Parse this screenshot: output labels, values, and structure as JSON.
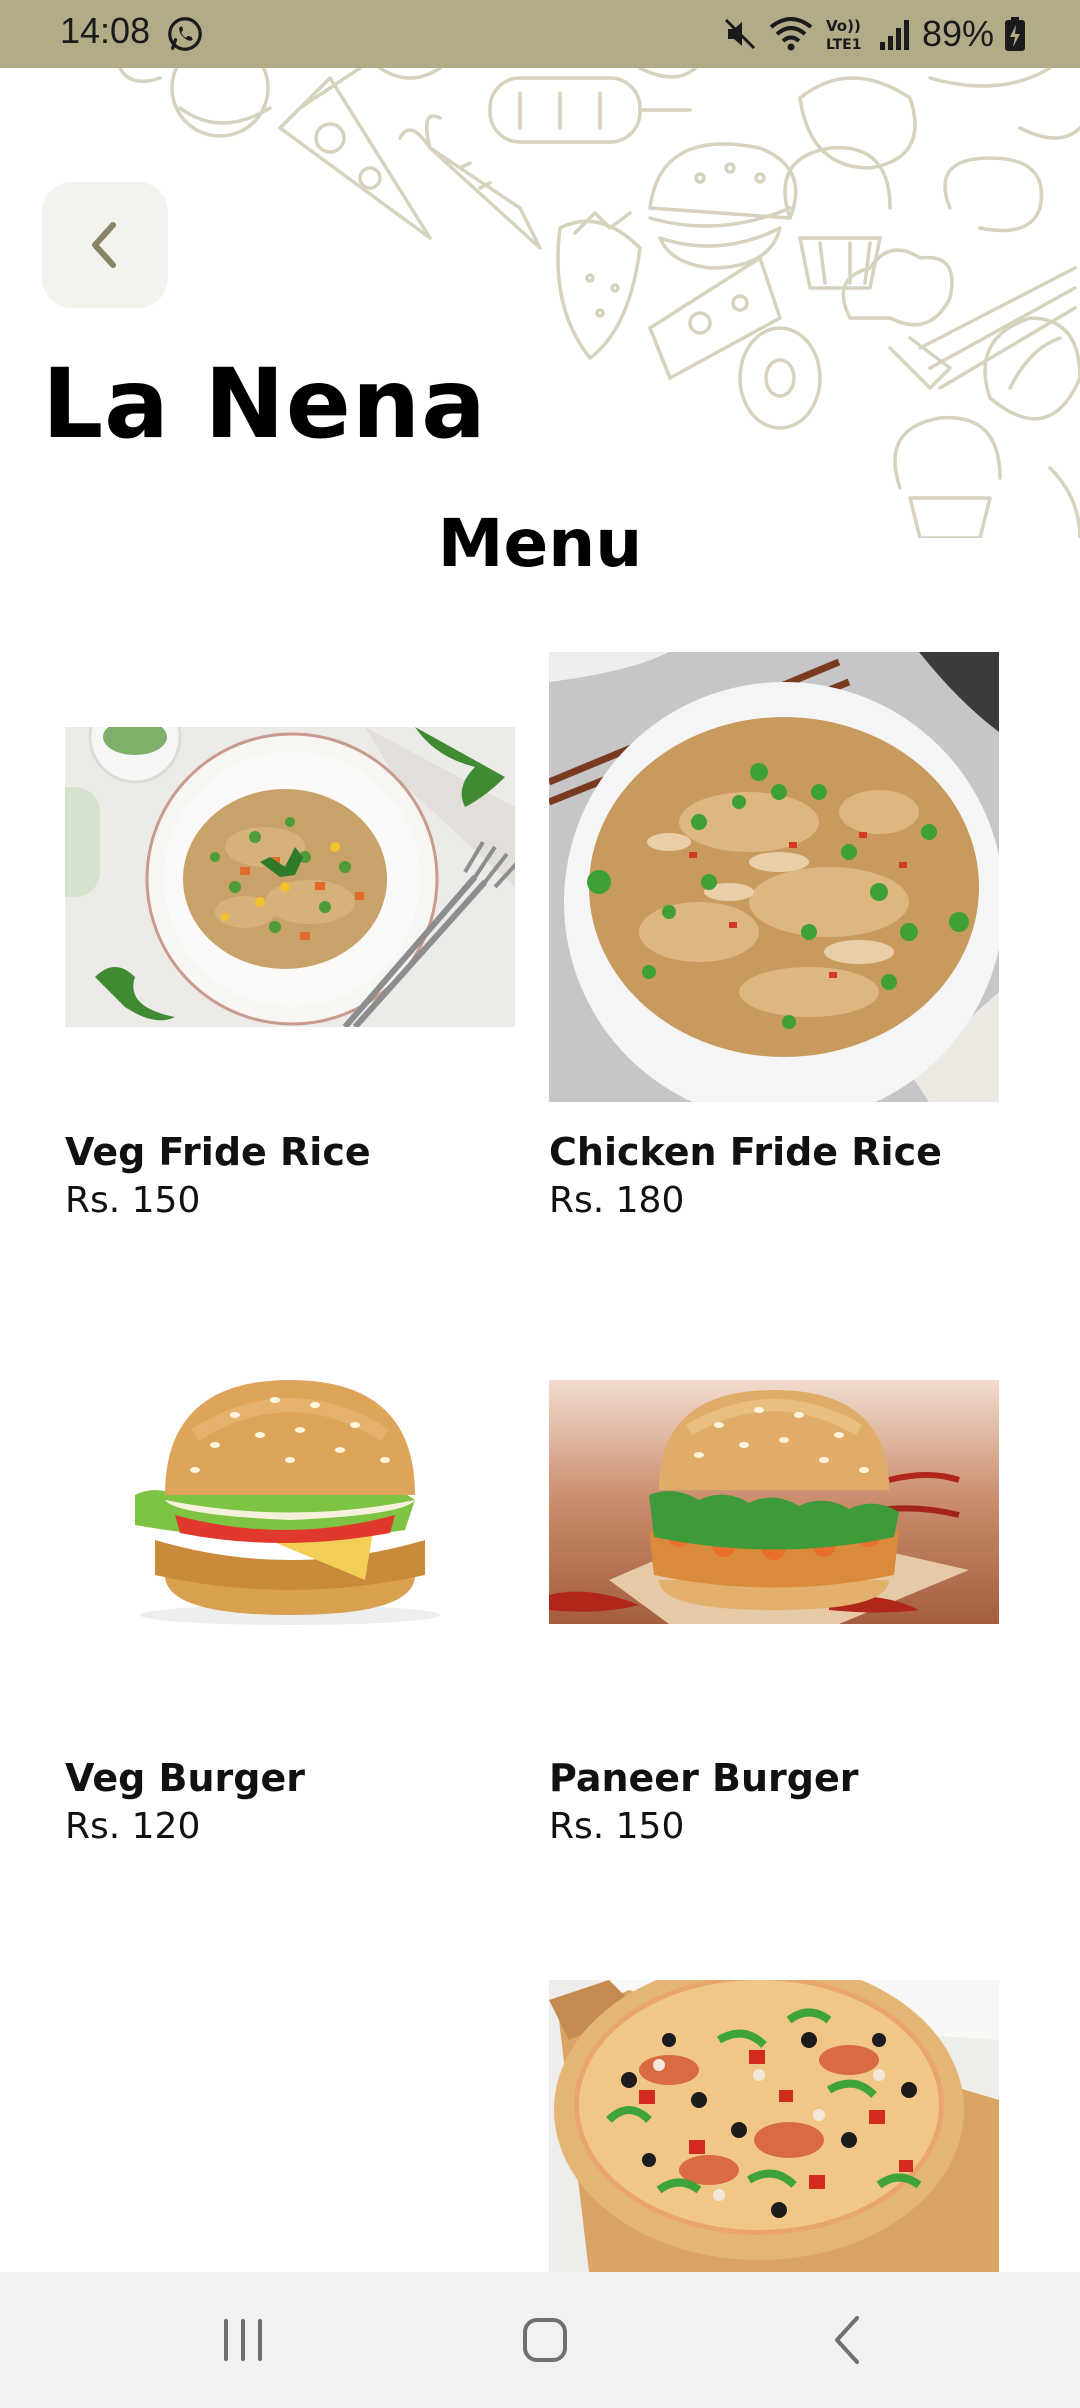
{
  "status_bar": {
    "time": "14:08",
    "battery": "89%",
    "icons": [
      "whatsapp-icon",
      "mute-icon",
      "wifi-icon",
      "volte-icon",
      "signal-icon",
      "battery-charging-icon"
    ]
  },
  "header": {
    "back_icon": "chevron-left-icon",
    "restaurant_name": "La Nena",
    "section_title": "Menu"
  },
  "menu_items": [
    {
      "name": "Veg Fride Rice",
      "price": "Rs. 150",
      "image": "veg-fried-rice-photo"
    },
    {
      "name": "Chicken Fride Rice",
      "price": "Rs. 180",
      "image": "chicken-fried-rice-photo"
    },
    {
      "name": "Veg Burger",
      "price": "Rs. 120",
      "image": "veg-burger-photo"
    },
    {
      "name": "Paneer Burger",
      "price": "Rs. 150",
      "image": "paneer-burger-photo"
    },
    {
      "name": "",
      "price": "",
      "image": "pizza-photo"
    }
  ],
  "nav_bar": {
    "icons": [
      "recent-apps-icon",
      "home-icon",
      "back-icon"
    ]
  },
  "colors": {
    "status_bar": "#b1ab88",
    "doodle_stroke": "#d6d2bd",
    "back_button_bg": "#f4f2ec",
    "nav_bar_bg": "#f2f1f1"
  }
}
